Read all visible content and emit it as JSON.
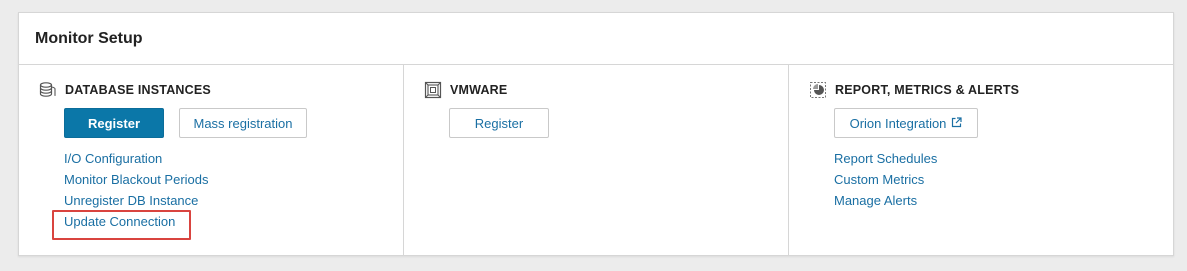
{
  "panel": {
    "title": "Monitor Setup"
  },
  "database": {
    "title": "DATABASE INSTANCES",
    "icon": "database-icon",
    "register_label": "Register",
    "mass_registration_label": "Mass registration",
    "links": [
      "I/O Configuration",
      "Monitor Blackout Periods",
      "Unregister DB Instance",
      "Update Connection"
    ],
    "highlighted_link": "Update Connection"
  },
  "vmware": {
    "title": "VMWARE",
    "icon": "vmware-icon",
    "register_label": "Register"
  },
  "reports": {
    "title": "REPORT, METRICS & ALERTS",
    "icon": "report-icon",
    "orion_label": "Orion Integration",
    "orion_icon": "external-link-icon",
    "links": [
      "Report Schedules",
      "Custom Metrics",
      "Manage Alerts"
    ]
  },
  "colors": {
    "primary": "#0b77a8",
    "link": "#1a6fa3",
    "highlight": "#d9443f"
  }
}
